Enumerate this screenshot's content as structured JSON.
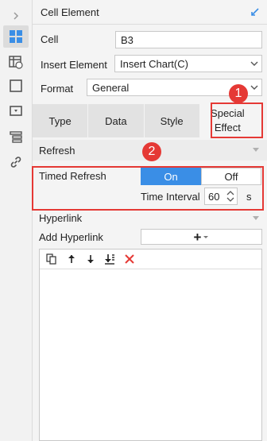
{
  "panel": {
    "title": "Cell Element"
  },
  "cell": {
    "label": "Cell",
    "value": "B3"
  },
  "insert_element": {
    "label": "Insert Element",
    "value": "Insert Chart(C)"
  },
  "format": {
    "label": "Format",
    "value": "General"
  },
  "tabs": [
    {
      "label": "Type"
    },
    {
      "label": "Data"
    },
    {
      "label": "Style"
    },
    {
      "label": "Special Effect"
    }
  ],
  "refresh": {
    "section_title": "Refresh",
    "timed_refresh_label": "Timed Refresh",
    "on_label": "On",
    "off_label": "Off",
    "interval_label": "Time Interval",
    "interval_value": "60",
    "interval_unit": "s"
  },
  "hyperlink": {
    "section_title": "Hyperlink",
    "add_label": "Add Hyperlink",
    "add_button_symbol": "+"
  },
  "callouts": {
    "one": "1",
    "two": "2"
  },
  "colors": {
    "accent": "#3a8ee6",
    "callout_red": "#e53935"
  },
  "icons": {
    "rail": [
      "expand-arrow-icon",
      "cell-element-icon",
      "cell-attribute-icon",
      "widget-icon",
      "form-icon",
      "condition-icon",
      "link-icon"
    ],
    "toolbar": [
      "copy-icon",
      "move-up-icon",
      "move-down-icon",
      "move-bottom-icon",
      "delete-icon"
    ]
  }
}
